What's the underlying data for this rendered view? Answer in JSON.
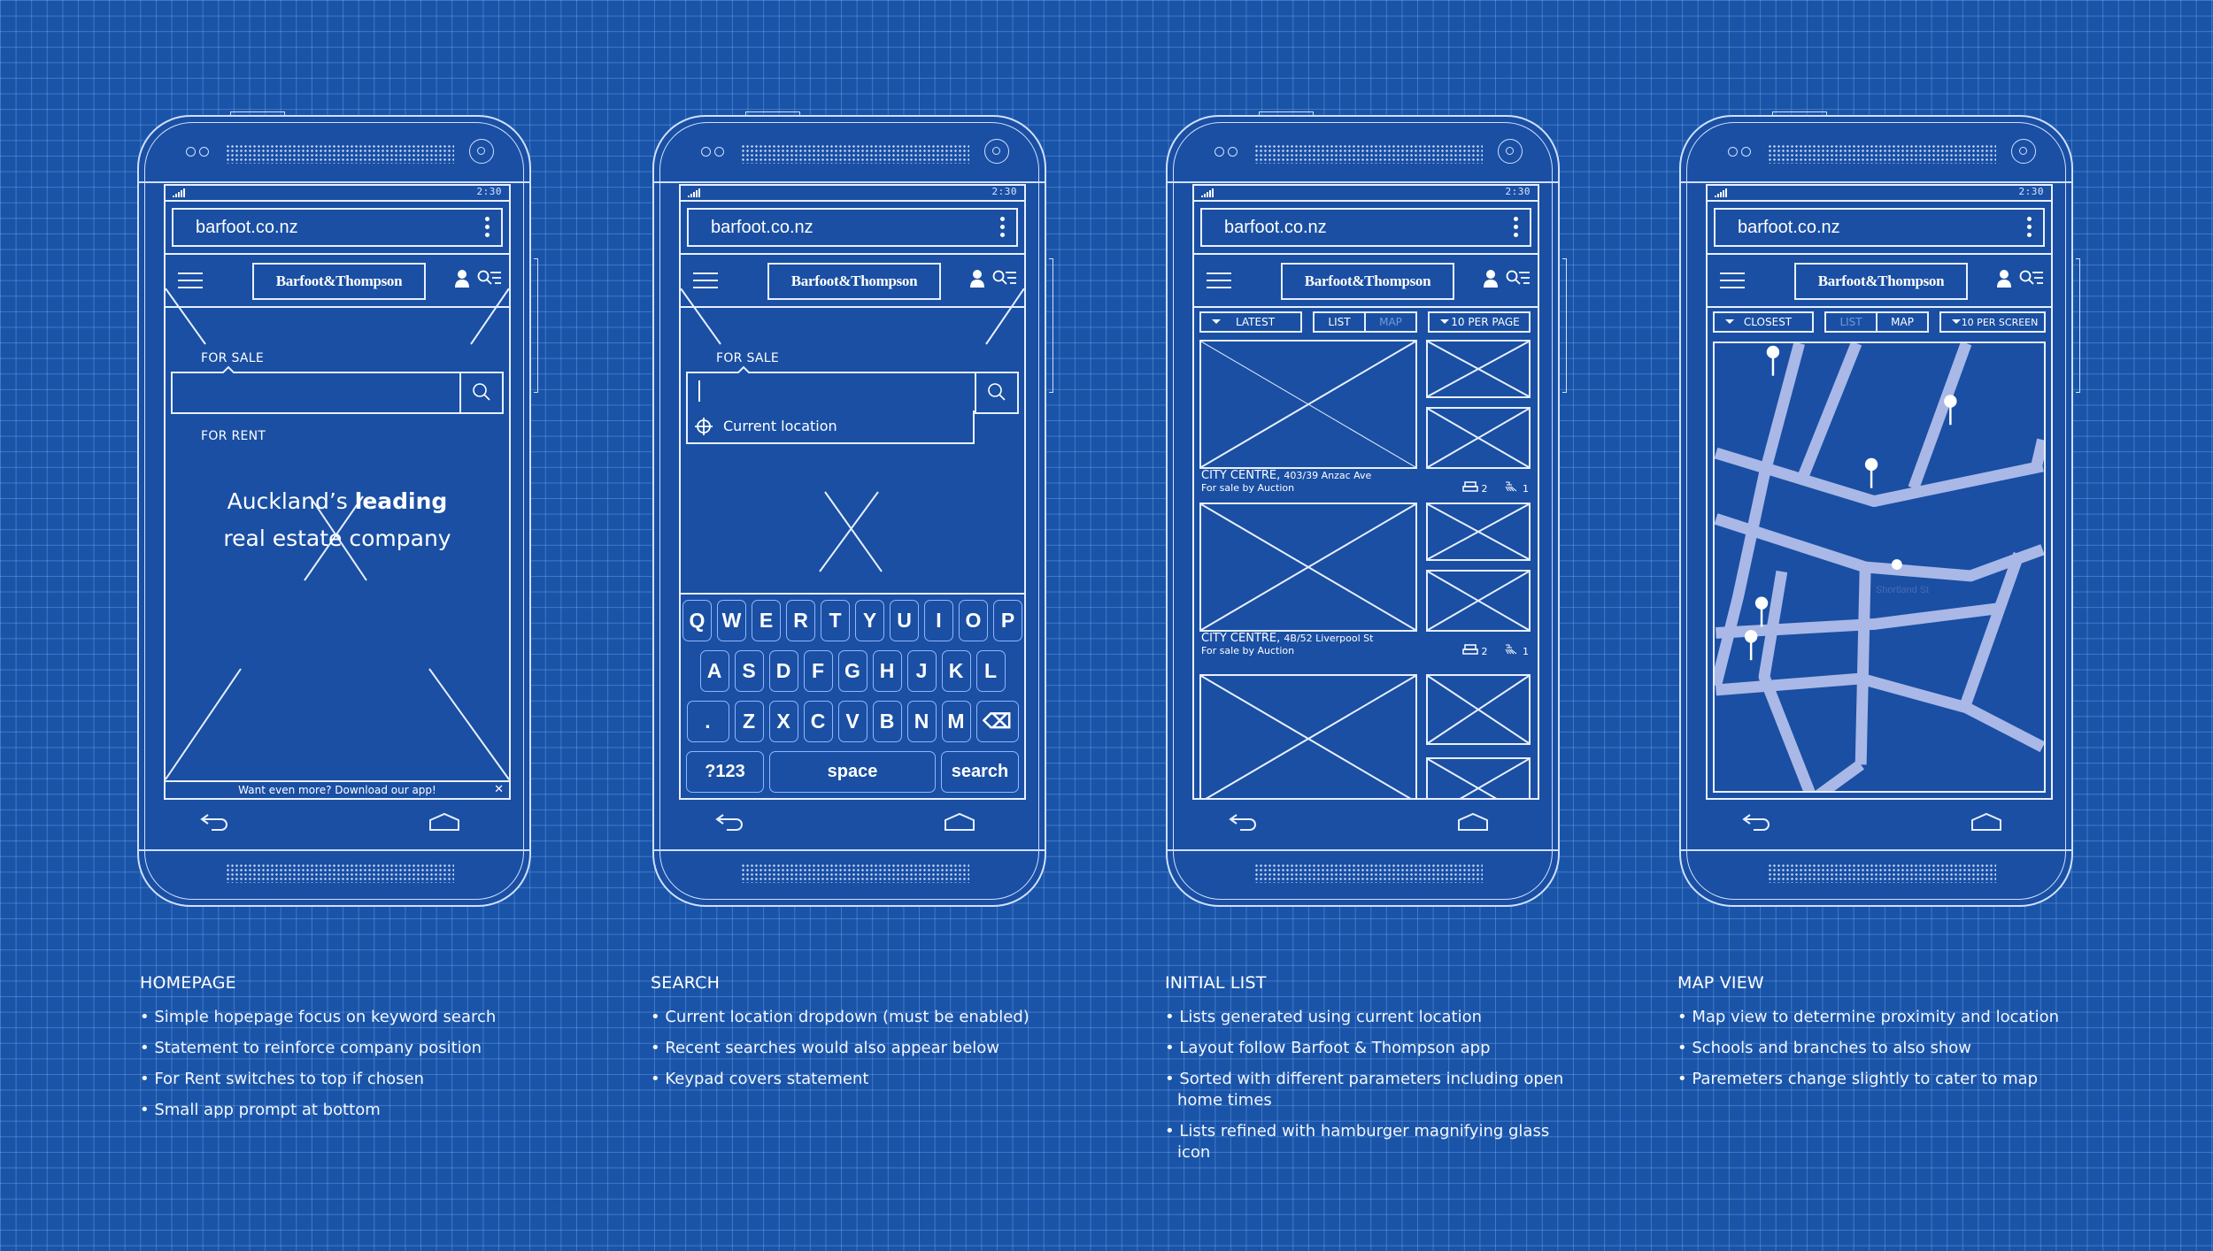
{
  "colors": {
    "background": "#1a54a8",
    "line": "#e8f0ff",
    "map_road": "#a9b8e6"
  },
  "common": {
    "status_time": "2:30",
    "url": "barfoot.co.nz",
    "brand": "Barfoot&Thompson"
  },
  "phones": [
    {
      "id": "homepage",
      "tab_label": "FOR SALE",
      "alt_tab_label": "FOR RENT",
      "headline_pre": "Auckland’s ",
      "headline_bold": "leading",
      "headline_line2": "real estate company",
      "search_placeholder": "",
      "app_banner": "Want even more? Download our app!",
      "app_banner_close": "✕"
    },
    {
      "id": "search",
      "tab_label": "FOR SALE",
      "search_value": "",
      "suggestion": "Current location",
      "keyboard": {
        "row1": [
          "Q",
          "W",
          "E",
          "R",
          "T",
          "Y",
          "U",
          "I",
          "O",
          "P"
        ],
        "row2": [
          "A",
          "S",
          "D",
          "F",
          "G",
          "H",
          "J",
          "K",
          "L"
        ],
        "row3": [
          ".",
          "Z",
          "X",
          "C",
          "V",
          "B",
          "N",
          "M"
        ],
        "backspace": "⌫",
        "numbers": "?123",
        "space": "space",
        "action": "search"
      }
    },
    {
      "id": "initial-list",
      "sort": "LATEST",
      "view_list": "LIST",
      "view_map": "MAP",
      "per_page": "10 PER PAGE",
      "listings": [
        {
          "area": "CITY CENTRE,",
          "address": "403/39 Anzac Ave",
          "sale_type": "For sale by Auction",
          "bedrooms": "2",
          "bathrooms": "1"
        },
        {
          "area": "CITY CENTRE,",
          "address": "4B/52 Liverpool St",
          "sale_type": "For sale by Auction",
          "bedrooms": "2",
          "bathrooms": "1"
        }
      ]
    },
    {
      "id": "map-view",
      "sort": "CLOSEST",
      "view_list": "LIST",
      "view_map": "MAP",
      "per_page": "10 PER SCREEN",
      "street_label": "Shortland St"
    }
  ],
  "notes": [
    {
      "title": "HOMEPAGE",
      "items": [
        "Simple hopepage focus on keyword search",
        "Statement to reinforce company position",
        "For Rent switches to top if chosen",
        "Small app prompt at bottom"
      ]
    },
    {
      "title": "SEARCH",
      "items": [
        "Current location  dropdown (must be enabled)",
        "Recent searches would also appear below",
        "Keypad covers statement"
      ]
    },
    {
      "title": "INITIAL LIST",
      "items": [
        "Lists generated using current location",
        "Layout follow Barfoot & Thompson app",
        "Sorted with different parameters including open home times",
        "Lists refined with hamburger magnifying glass icon"
      ]
    },
    {
      "title": "MAP VIEW",
      "items": [
        "Map view to determine proximity and location",
        "Schools and branches to also show",
        "Paremeters change slightly to cater to map"
      ]
    }
  ]
}
